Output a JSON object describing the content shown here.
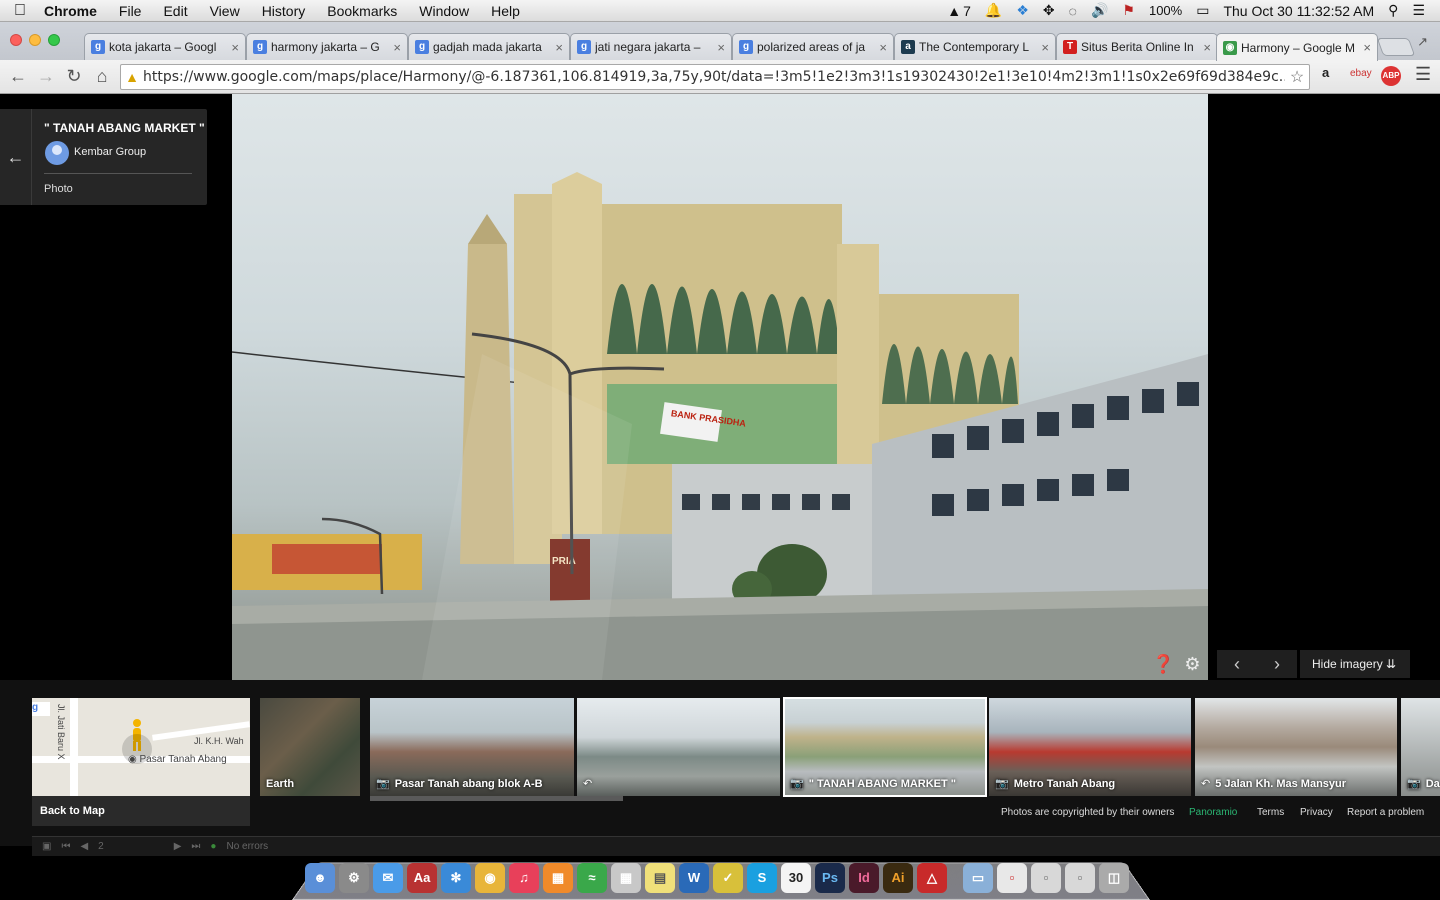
{
  "menubar": {
    "app": "Chrome",
    "items": [
      "File",
      "Edit",
      "View",
      "History",
      "Bookmarks",
      "Window",
      "Help"
    ],
    "status": {
      "adobe_count": "7",
      "battery": "100%",
      "datetime": "Thu Oct 30  11:32:52 AM"
    }
  },
  "tabs": [
    {
      "title": "kota jakarta – Googl",
      "favicon": "google-icon",
      "color": "#4a7fe0"
    },
    {
      "title": "harmony jakarta – G",
      "favicon": "google-icon",
      "color": "#4a7fe0"
    },
    {
      "title": "gadjah mada jakarta",
      "favicon": "google-icon",
      "color": "#4a7fe0"
    },
    {
      "title": "jati negara jakarta –",
      "favicon": "google-icon",
      "color": "#4a7fe0"
    },
    {
      "title": "polarized areas of ja",
      "favicon": "google-icon",
      "color": "#4a7fe0"
    },
    {
      "title": "The Contemporary L",
      "favicon": "academia-icon",
      "color": "#1d3b4f"
    },
    {
      "title": "Situs Berita Online In",
      "favicon": "tempo-icon",
      "color": "#d21f1f"
    },
    {
      "title": "Harmony – Google M",
      "favicon": "maps-icon",
      "color": "#3a9a4a"
    }
  ],
  "toolbar": {
    "url": "https://www.google.com/maps/place/Harmony/@-6.187361,106.814919,3a,75y,90t/data=!3m5!1e2!3m3!1s19302430!2e1!3e10!4m2!3m1!1s0x2e69f69d384e9c...",
    "url_host": "www.google.com",
    "extensions": [
      "amazon-icon",
      "ebay-icon",
      "adblock-icon",
      "menu-icon"
    ]
  },
  "photo_panel": {
    "title": "\" TANAH ABANG MARKET \"",
    "author": "Kembar Group",
    "type": "Photo"
  },
  "photo": {
    "signs": [
      "BANK PRASIDHA",
      "PRIA SELERA"
    ]
  },
  "viewer": {
    "hide_imagery": "Hide imagery"
  },
  "filmstrip": {
    "map": {
      "label_street1": "Jl. Jati Baru X",
      "label_street2": "Jl. K.H. Wah",
      "place": "Pasar Tanah Abang",
      "back": "Back to Map"
    },
    "items": [
      {
        "caption": "Earth",
        "icon": ""
      },
      {
        "caption": "Pasar Tanah abang blok A-B",
        "icon": "camera-icon"
      },
      {
        "caption": "",
        "icon": "panorama-icon"
      },
      {
        "caption": "\" TANAH ABANG MARKET \"",
        "icon": "camera-icon",
        "selected": true
      },
      {
        "caption": "Metro Tanah Abang",
        "icon": "camera-icon"
      },
      {
        "caption": "5 Jalan Kh. Mas Mansyur",
        "icon": "panorama-icon"
      },
      {
        "caption": "Da",
        "icon": "camera-icon"
      }
    ],
    "footer": {
      "copyright": "Photos are copyrighted by their owners",
      "brand": "Panoramio",
      "terms": "Terms",
      "privacy": "Privacy",
      "report": "Report a problem"
    }
  },
  "devbar": {
    "page": "2",
    "status": "No errors"
  },
  "colors": {
    "accent": "#4a7fe0",
    "panoramio": "#2bb673"
  }
}
